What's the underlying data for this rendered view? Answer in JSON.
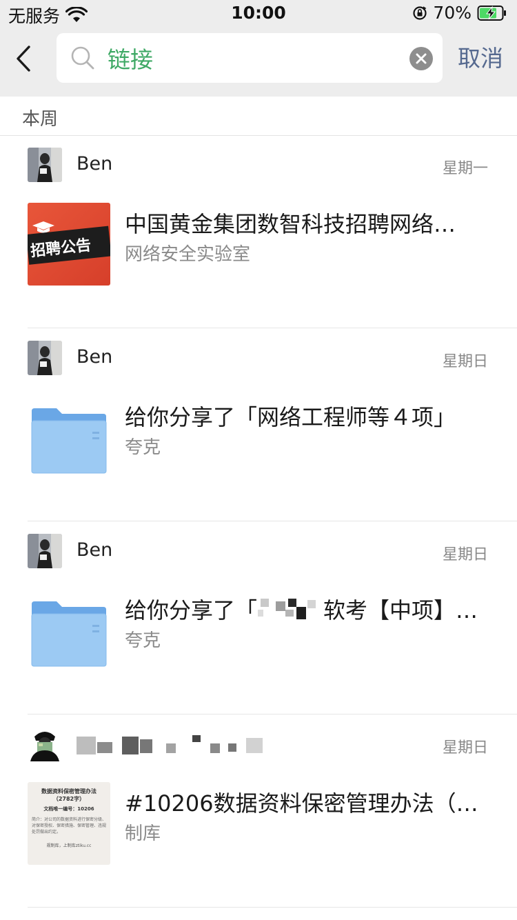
{
  "status_bar": {
    "carrier": "无服务",
    "time": "10:00",
    "battery_percent": "70%"
  },
  "search": {
    "query": "链接",
    "cancel_label": "取消"
  },
  "section_label": "本周",
  "entries": [
    {
      "sender": "Ben",
      "date": "星期一",
      "title": "中国黄金集团数智科技招聘网络…",
      "source": "网络安全实验室",
      "thumb": "recruit",
      "thumb_text": "招聘公告"
    },
    {
      "sender": "Ben",
      "date": "星期日",
      "title": "给你分享了「网络工程师等４项」",
      "source": "夸克",
      "thumb": "folder"
    },
    {
      "sender": "Ben",
      "date": "星期日",
      "title": "给你分享了「　　　软考【中项】…",
      "source": "夸克",
      "thumb": "folder"
    },
    {
      "sender": "",
      "date": "星期日",
      "title": "#10206数据资料保密管理办法（…",
      "source": "制库",
      "thumb": "document",
      "doc_title": "数据资料保密管理办法（2782字）",
      "doc_number": "文档唯一编号：10206",
      "doc_body": "简介：对公司的数据资料进行保密分级、对保密授权、保密措施、保密管理、违规处罚做出约定。",
      "doc_footer": "规制库，上制库ztiku.cc"
    }
  ]
}
